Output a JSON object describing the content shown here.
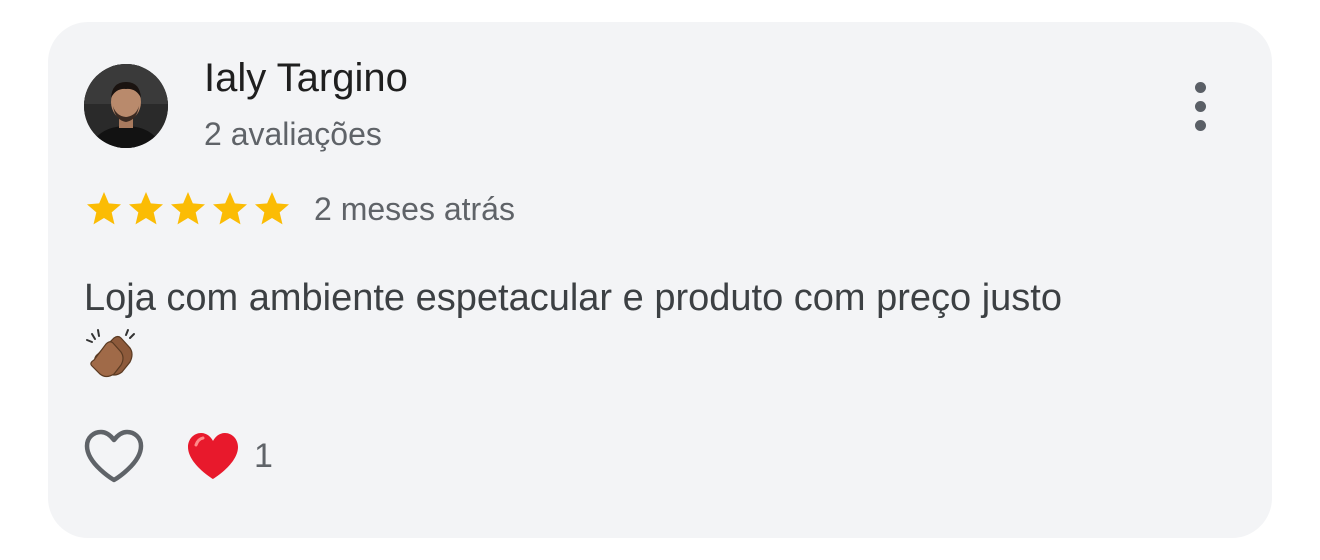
{
  "review": {
    "author": {
      "name": "Ialy Targino",
      "reviews_count_label": "2 avaliações"
    },
    "rating": {
      "stars": 5,
      "max": 5,
      "star_color": "#fbbc04"
    },
    "time_ago": "2 meses atrás",
    "text": "Loja com ambiente espetacular e produto com preço justo",
    "text_emoji": "clapping-hands-medium-dark-skin-tone",
    "actions": {
      "like_icon": "heart-outline-icon",
      "reaction_icon": "red-heart-icon",
      "reaction_count": "1"
    },
    "menu_icon": "more-vertical-icon"
  },
  "colors": {
    "card_background": "#f3f4f6",
    "primary_text": "#1f1f1f",
    "secondary_text": "#5f6368",
    "heart_red": "#e8192c"
  }
}
